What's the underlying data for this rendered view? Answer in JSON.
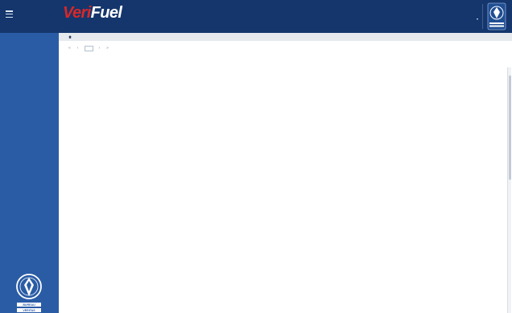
{
  "header": {
    "brand_prefix": "Veri",
    "brand_suffix": "Fuel",
    "tagline": "",
    "user": "",
    "badge_text": "BUREAU VERITAS"
  },
  "sidebar": {
    "items": [],
    "footer_text": "BUREAU VERITAS"
  },
  "breadcrumb": {
    "label": ""
  },
  "pager": {
    "first": "«",
    "prev": "‹",
    "page": "",
    "next": "›",
    "last": "»",
    "info": ""
  },
  "toolbar": {
    "actions": []
  },
  "table": {
    "columns": [],
    "rows": []
  },
  "colors": {
    "header": "#14366d",
    "sidebar": "#2a5ca6",
    "table_header": "#1f4e93",
    "spec_met": "#2e9d44",
    "follow_caution": "#e87017",
    "follow_normal": "#2e9d44"
  },
  "icons": {
    "menu": "hamburger",
    "home": "home-icon",
    "report": "pdf-icon"
  }
}
